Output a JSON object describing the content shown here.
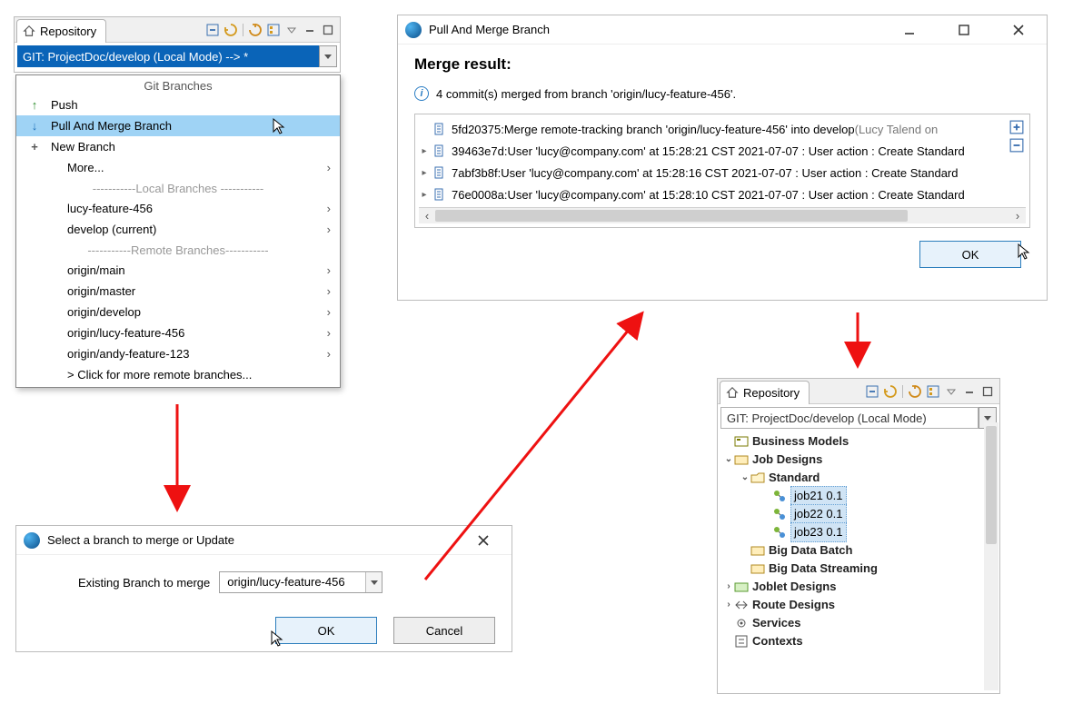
{
  "repo_panel": {
    "tab": "Repository",
    "branch_field": "GIT: ProjectDoc/develop   (Local Mode)    -->  *"
  },
  "branch_menu": {
    "header": "Git Branches",
    "push": "Push",
    "pull_merge": "Pull And Merge Branch",
    "new_branch": "New Branch",
    "more": "More...",
    "sep_local": "-----------Local   Branches -----------",
    "local_1": "lucy-feature-456",
    "local_2": "develop (current)",
    "sep_remote": "-----------Remote Branches-----------",
    "remote_1": "origin/main",
    "remote_2": "origin/master",
    "remote_3": "origin/develop",
    "remote_4": "origin/lucy-feature-456",
    "remote_5": "origin/andy-feature-123",
    "more_remote": "> Click for more remote branches..."
  },
  "select_dlg": {
    "title": "Select a branch to merge or Update",
    "label": "Existing Branch to merge",
    "value": "origin/lucy-feature-456",
    "ok": "OK",
    "cancel": "Cancel"
  },
  "merge_dlg": {
    "title": "Pull And Merge Branch",
    "heading": "Merge result:",
    "info": "4 commit(s) merged from branch 'origin/lucy-feature-456'.",
    "commits": [
      {
        "exp": "",
        "hash": "5fd20375:",
        "msg": "Merge remote-tracking branch 'origin/lucy-feature-456' into develop",
        "tail": "(Lucy Talend on"
      },
      {
        "exp": "▸",
        "hash": "39463e7d:",
        "msg": "User 'lucy@company.com' at 15:28:21 CST 2021-07-07 :  User action : Create Standard",
        "tail": ""
      },
      {
        "exp": "▸",
        "hash": "7abf3b8f:",
        "msg": "User 'lucy@company.com' at 15:28:16 CST 2021-07-07 :  User action : Create Standard",
        "tail": ""
      },
      {
        "exp": "▸",
        "hash": "76e0008a:",
        "msg": "User 'lucy@company.com' at 15:28:10 CST 2021-07-07 :  User action : Create Standard",
        "tail": ""
      }
    ],
    "ok": "OK"
  },
  "result_panel": {
    "tab": "Repository",
    "branch_field": "GIT: ProjectDoc/develop   (Local Mode)",
    "tree": {
      "business_models": "Business Models",
      "job_designs": "Job Designs",
      "standard": "Standard",
      "job21": "job21 0.1",
      "job22": "job22 0.1",
      "job23": "job23 0.1",
      "big_data_batch": "Big Data Batch",
      "big_data_streaming": "Big Data Streaming",
      "joblet_designs": "Joblet Designs",
      "route_designs": "Route Designs",
      "services": "Services",
      "contexts": "Contexts"
    }
  }
}
